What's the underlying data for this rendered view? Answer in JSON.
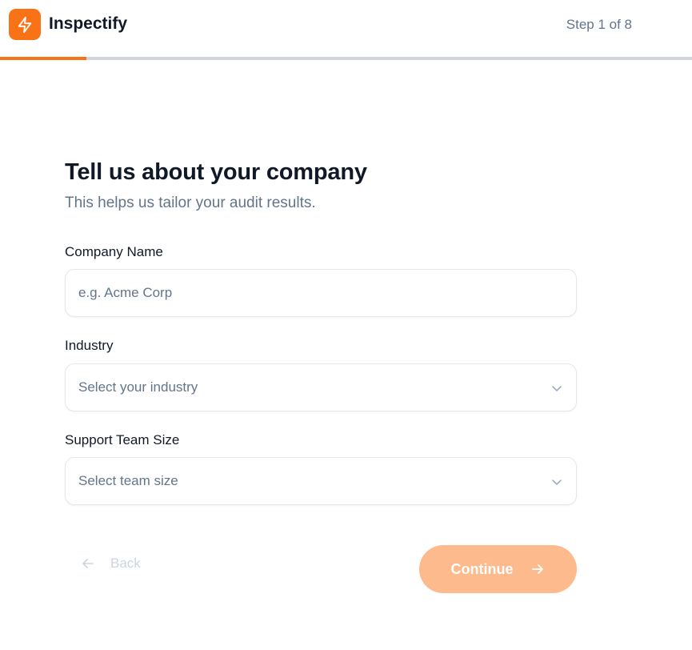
{
  "header": {
    "brand": "Inspectify",
    "step_text": "Step 1 of 8",
    "progress_fraction": 0.125,
    "logo_icon": "lightning-bolt-icon"
  },
  "colors": {
    "accent": "#f97316",
    "accent_disabled": "#fdba8c",
    "text_primary": "#111827",
    "text_muted": "#64748b",
    "border": "#e2e8f0"
  },
  "form": {
    "title": "Tell us about your company",
    "subtitle": "This helps us tailor your audit results.",
    "company_name": {
      "label": "Company Name",
      "placeholder": "e.g. Acme Corp",
      "value": ""
    },
    "industry": {
      "label": "Industry",
      "selected": "Select your industry"
    },
    "team_size": {
      "label": "Support Team Size",
      "selected": "Select team size"
    }
  },
  "actions": {
    "back_label": "Back",
    "continue_label": "Continue",
    "continue_enabled": false
  }
}
